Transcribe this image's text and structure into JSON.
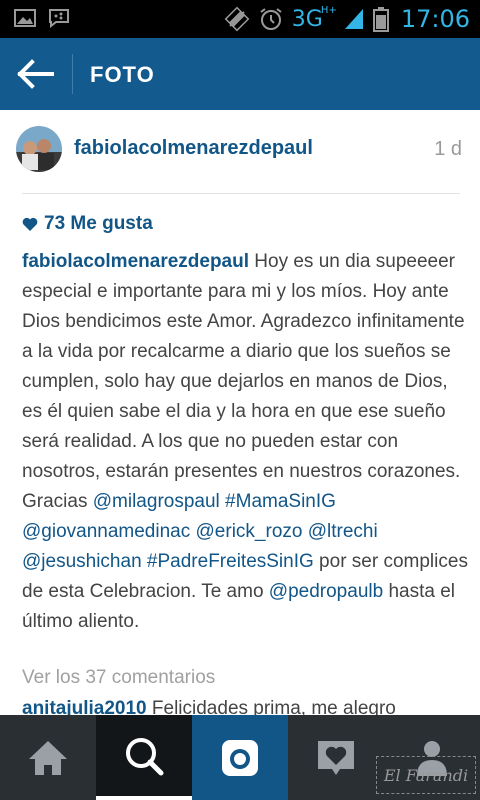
{
  "statusbar": {
    "network": "3G",
    "network_sup": "H+",
    "time": "17:06",
    "icons": [
      "image-icon",
      "bbm-icon",
      "signal-off-icon",
      "alarm-icon",
      "signal-icon",
      "battery-icon"
    ]
  },
  "header": {
    "title": "FOTO",
    "back_icon": "arrow-left-icon"
  },
  "post": {
    "username": "fabiolacolmenarezdepaul",
    "time_ago": "1 d",
    "likes": "73 Me gusta",
    "caption_user": "fabiolacolmenarezdepaul",
    "caption_text_1": " Hoy es un dia supeeeer especial e importante para mi y los míos. Hoy ante Dios bendicimos este Amor. Agradezco infinitamente a la vida por recalcarme a diario que los sueños se cumplen, solo hay que dejarlos en manos de Dios, es él quien sabe el dia y la hora en que ese sueño será realidad. A los que no pueden estar con nosotros, estarán presentes en nuestros corazones. Gracias ",
    "mentions": [
      "@milagrospaul",
      "#MamaSinIG",
      "@giovannamedinac",
      "@erick_rozo",
      "@ltrechi",
      "@jesushichan",
      "#PadreFreitesSinIG"
    ],
    "caption_text_2": " por ser complices de esta Celebracion. Te amo ",
    "mention_last": "@pedropaulb",
    "caption_text_3": "  hasta el último aliento.",
    "view_comments": "Ver los 37 comentarios",
    "comment_user": "anitajulia2010",
    "comment_text": " Felicidades prima, me alegro"
  },
  "bottom_nav": [
    "home-icon",
    "search-icon",
    "camera-icon",
    "activity-icon",
    "profile-icon"
  ],
  "watermark": "El Farandi",
  "colors": {
    "statusbar_bg": "#000000",
    "header_bg": "#135a8e",
    "accent": "#125688",
    "nav_bg": "#2a2f34",
    "status_text": "#33b5e5"
  }
}
